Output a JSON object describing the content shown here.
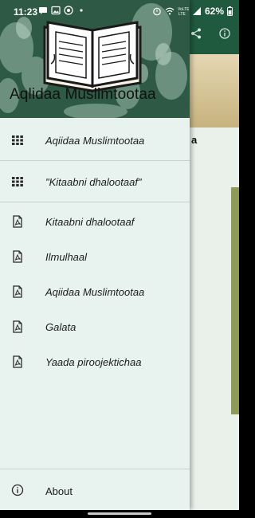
{
  "status_bar": {
    "time": "11:23",
    "battery": "62%",
    "notification_icons": [
      "messaging-icon",
      "gallery-icon",
      "app-icon",
      "dot-icon"
    ],
    "system_icons": [
      "alarm-icon",
      "wifi-icon",
      "volte-lte-icon",
      "signal-icon",
      "battery-icon"
    ]
  },
  "background_app": {
    "card_title": "a",
    "toolbar_icons": [
      "share-icon",
      "info-icon"
    ]
  },
  "drawer": {
    "header": {
      "title": "Aqlidaa Muslimtootaa",
      "logo": "open-book-icon"
    },
    "menu_items": [
      {
        "label": "Aqiidaa Muslimtootaa",
        "icon": "grid-icon"
      },
      {
        "label": "\"Kitaabni dhalootaaf\"",
        "icon": "grid-icon"
      },
      {
        "label": "Kitaabni dhalootaaf",
        "icon": "pdf-icon"
      },
      {
        "label": "Ilmulhaal",
        "icon": "pdf-icon"
      },
      {
        "label": "Aqiidaa Muslimtootaa",
        "icon": "pdf-icon"
      },
      {
        "label": "Galata",
        "icon": "pdf-icon"
      },
      {
        "label": "Yaada piroojektichaa",
        "icon": "pdf-icon"
      }
    ],
    "footer": {
      "label": "About",
      "icon": "info-icon"
    }
  }
}
